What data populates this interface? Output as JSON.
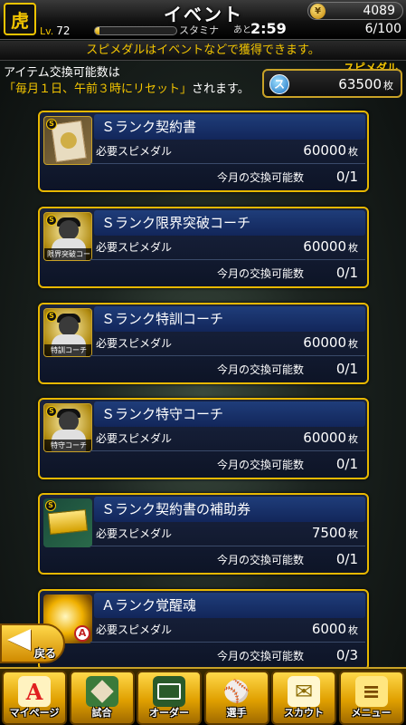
{
  "header": {
    "title": "イベント",
    "team_logo": "虎",
    "level_prefix": "Lv.",
    "level": "72",
    "stamina_label": "スタミナ",
    "stamina_fill": 0.06,
    "ato_label": "あと",
    "time_remaining": "2:59",
    "stamina_count": "6/100",
    "coins": "4089",
    "coin_icon": "coin-icon"
  },
  "notice": "スピメダルはイベントなどで獲得できます。",
  "info": {
    "line1": "アイテム交換可能数は",
    "line2_reset": "「毎月１日、午前３時にリセット」",
    "line2_rest": "されます。"
  },
  "medal": {
    "label": "スピメダル",
    "icon_letter": "ス",
    "value": "63500",
    "unit": "枚"
  },
  "items": [
    {
      "name": "Ｓランク契約書",
      "req_label": "必要スピメダル",
      "req_value": "60000",
      "unit": "枚",
      "limit_label": "今月の交換可能数",
      "limit_value": "0/1",
      "thumb_icon": "contract-icon"
    },
    {
      "name": "Ｓランク限界突破コーチ",
      "req_label": "必要スピメダル",
      "req_value": "60000",
      "unit": "枚",
      "limit_label": "今月の交換可能数",
      "limit_value": "0/1",
      "thumb_icon": "coach-icon",
      "thumb_caption": "限界突破コーチ"
    },
    {
      "name": "Ｓランク特訓コーチ",
      "req_label": "必要スピメダル",
      "req_value": "60000",
      "unit": "枚",
      "limit_label": "今月の交換可能数",
      "limit_value": "0/1",
      "thumb_icon": "coach-icon",
      "thumb_caption": "特訓コーチ"
    },
    {
      "name": "Ｓランク特守コーチ",
      "req_label": "必要スピメダル",
      "req_value": "60000",
      "unit": "枚",
      "limit_label": "今月の交換可能数",
      "limit_value": "0/1",
      "thumb_icon": "coach-icon",
      "thumb_caption": "特守コーチ"
    },
    {
      "name": "Ｓランク契約書の補助券",
      "req_label": "必要スピメダル",
      "req_value": "7500",
      "unit": "枚",
      "limit_label": "今月の交換可能数",
      "limit_value": "0/1",
      "thumb_icon": "ticket-icon"
    },
    {
      "name": "Ａランク覚醒魂",
      "req_label": "必要スピメダル",
      "req_value": "6000",
      "unit": "枚",
      "limit_label": "今月の交換可能数",
      "limit_value": "0/3",
      "thumb_icon": "soul-icon",
      "thumb_badge": "A"
    }
  ],
  "badge_s": "S",
  "back_label": "戻る",
  "nav": [
    {
      "label": "マイページ",
      "icon": "A",
      "icon_name": "mypage-icon"
    },
    {
      "label": "試合",
      "icon": "",
      "icon_name": "field-icon"
    },
    {
      "label": "オーダー",
      "icon": "",
      "icon_name": "order-icon"
    },
    {
      "label": "選手",
      "icon": "⚾",
      "icon_name": "player-icon"
    },
    {
      "label": "スカウト",
      "icon": "✉",
      "icon_name": "scout-icon"
    },
    {
      "label": "メニュー",
      "icon": "≡",
      "icon_name": "menu-icon"
    }
  ]
}
